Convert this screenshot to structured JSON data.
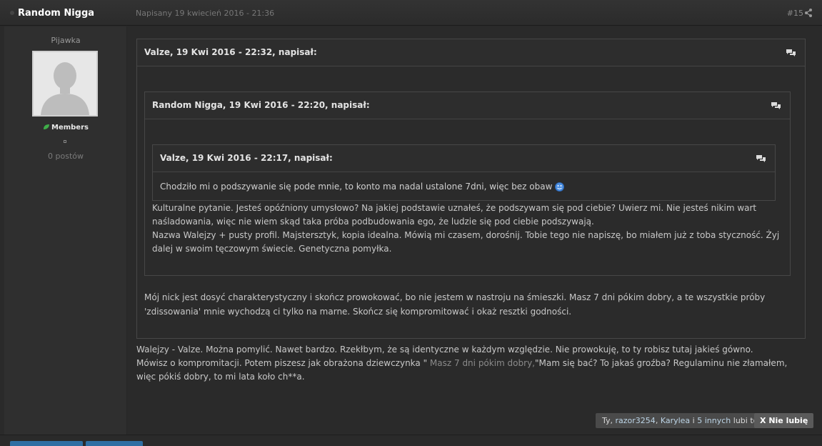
{
  "post": {
    "author": "Random Nigga",
    "date": "Napisany 19 kwiecień 2016 - 21:36",
    "number": "#15"
  },
  "sidebar": {
    "rank": "Pijawka",
    "group": "Members",
    "post_count": "0 postów"
  },
  "quotes": {
    "outer": {
      "cite": "Valze, 19 Kwi 2016 - 22:32, napisał:",
      "text": "Mój nick jest dosyć charakterystyczny i skończ prowokować, bo nie jestem w nastroju na śmieszki. Masz 7 dni pókim dobry, a te wszystkie próby 'zdissowania' mnie wychodzą ci tylko na marne. Skończ się kompromitować i okaż resztki godności."
    },
    "middle": {
      "cite": "Random Nigga, 19 Kwi 2016 - 22:20, napisał:",
      "text": "Kulturalne pytanie. Jesteś opóźniony umysłowo? Na jakiej podstawie uznałeś, że podszywam się pod ciebie? Uwierz mi. Nie jesteś nikim wart naśladowania, więc nie wiem skąd taka próba podbudowania ego, że ludzie się pod ciebie podszywają.\nNazwa Walejzy + pusty profil. Majstersztyk, kopia idealna. Mówią mi czasem, dorośnij. Tobie tego nie napiszę, bo miałem już z toba styczność. Żyj dalej w swoim tęczowym świecie. Genetyczna pomyłka."
    },
    "inner": {
      "cite": "Valze, 19 Kwi 2016 - 22:17, napisał:",
      "text": "Chodziło mi o podszywanie się pode mnie, to konto ma nadal ustalone 7dni, więc bez obaw"
    }
  },
  "body": {
    "line1": "Walejzy - Valze. Można pomylić. Nawet bardzo. Rzekłbym, że są identyczne w każdym względzie. Nie prowokuję, to ty robisz tutaj jakieś gówno.",
    "line2_a": "Mówisz o kompromitacji. Potem piszesz jak obrażona dziewczynka \" ",
    "line2_quote": "Masz 7 dni pókim dobry,",
    "line2_b": "\"Mam się bać? To jakaś groźba? Regulaminu nie złamałem, więc pókiś dobry, to mi lata koło ch**a."
  },
  "likes": {
    "prefix": "Ty, ",
    "user1": "razor3254",
    "sep": ", ",
    "user2": "Karylea",
    "mid": " i ",
    "others": "5 innych",
    "suffix": " lubi to",
    "unlike_label": "Nie lubię"
  },
  "icons": {
    "share": "share-icon",
    "quote": "speech-bubbles-icon",
    "smiley": "smiley-icon",
    "group": "leaf-icon"
  },
  "colors": {
    "accent_link": "#bcd4e6",
    "group_icon": "#3fae49",
    "bottom_button": "#2f6fa3"
  }
}
